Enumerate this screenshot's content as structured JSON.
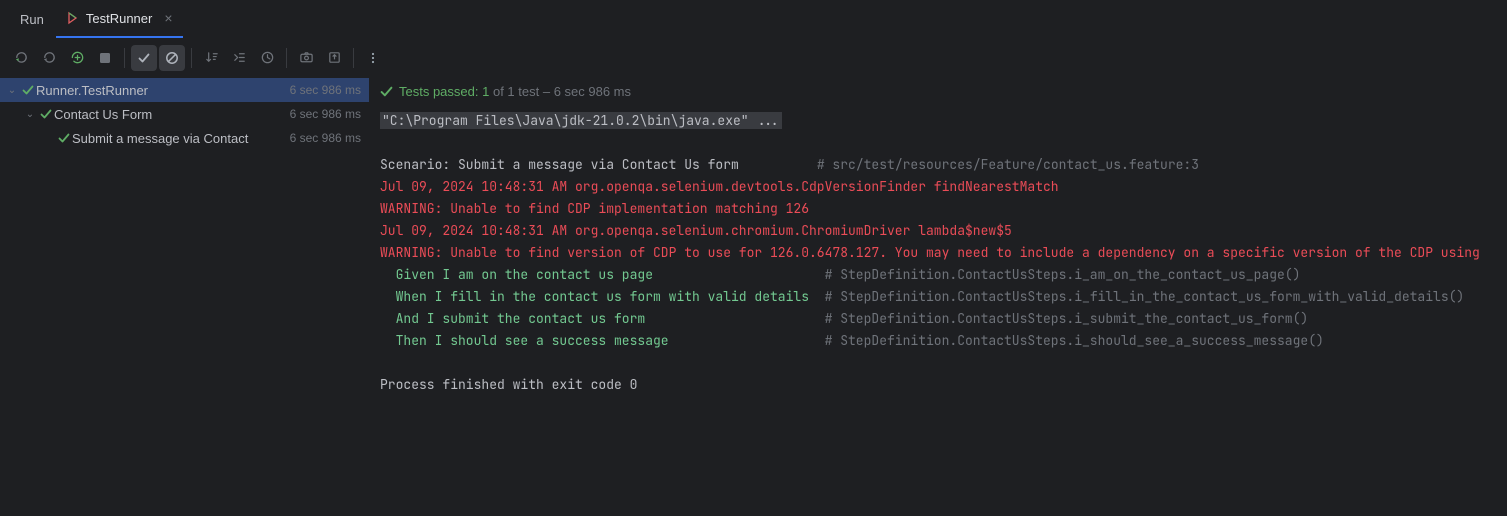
{
  "tabbar": {
    "run_label": "Run",
    "tab_title": "TestRunner"
  },
  "status": {
    "prefix": "Tests passed:",
    "passed_count": "1",
    "of_text": " of 1 test – ",
    "duration": "6 sec 986 ms"
  },
  "tree": {
    "root": {
      "name": "Runner.TestRunner",
      "time": "6 sec 986 ms"
    },
    "child": {
      "name": "Contact Us Form",
      "time": "6 sec 986 ms"
    },
    "leaf": {
      "name": "Submit a message via Contact",
      "time": "6 sec 986 ms"
    }
  },
  "console": {
    "cmd": "\"C:\\Program Files\\Java\\jdk-21.0.2\\bin\\java.exe\" ...",
    "scenario_line": "Scenario: Submit a message via Contact Us form          ",
    "scenario_src": "# src/test/resources/Feature/contact_us.feature:3",
    "red1": "Jul 09, 2024 10:48:31 AM org.openqa.selenium.devtools.CdpVersionFinder findNearestMatch",
    "red2": "WARNING: Unable to find CDP implementation matching 126",
    "red3": "Jul 09, 2024 10:48:31 AM org.openqa.selenium.chromium.ChromiumDriver lambda$new$5",
    "red4": "WARNING: Unable to find version of CDP to use for 126.0.6478.127. You may need to include a dependency on a specific version of the CDP using",
    "step1": "  Given I am on the contact us page                      ",
    "step1_src": "# StepDefinition.ContactUsSteps.i_am_on_the_contact_us_page()",
    "step2": "  When I fill in the contact us form with valid details ",
    "step2_src": " # StepDefinition.ContactUsSteps.i_fill_in_the_contact_us_form_with_valid_details()",
    "step3": "  And I submit the contact us form                       ",
    "step3_src": "# StepDefinition.ContactUsSteps.i_submit_the_contact_us_form()",
    "step4": "  Then I should see a success message                    ",
    "step4_src": "# StepDefinition.ContactUsSteps.i_should_see_a_success_message()",
    "exit": "Process finished with exit code 0"
  }
}
